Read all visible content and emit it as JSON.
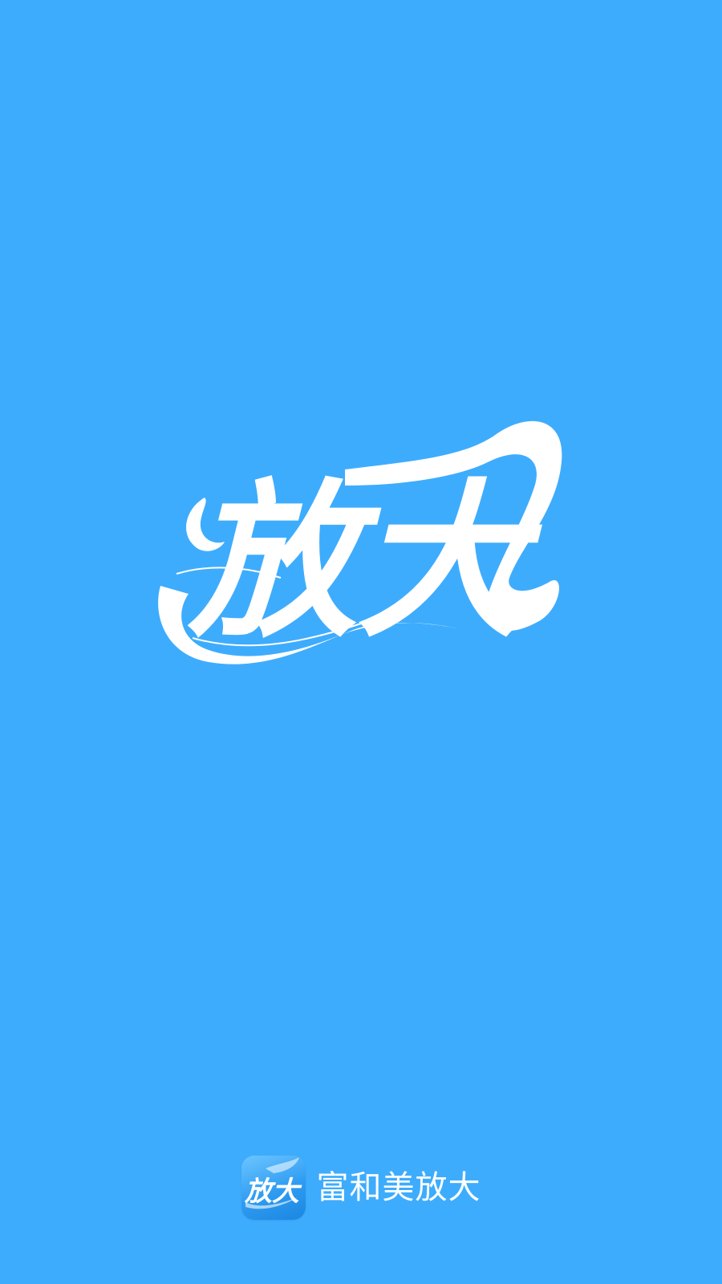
{
  "splash": {
    "background_color": "#3eacfd",
    "logo": {
      "text": "放大",
      "color": "#ffffff",
      "icon": "calligraphy-logo-icon"
    }
  },
  "footer": {
    "app_icon": {
      "text": "放大",
      "icon": "app-icon"
    },
    "app_name": "富和美放大"
  }
}
